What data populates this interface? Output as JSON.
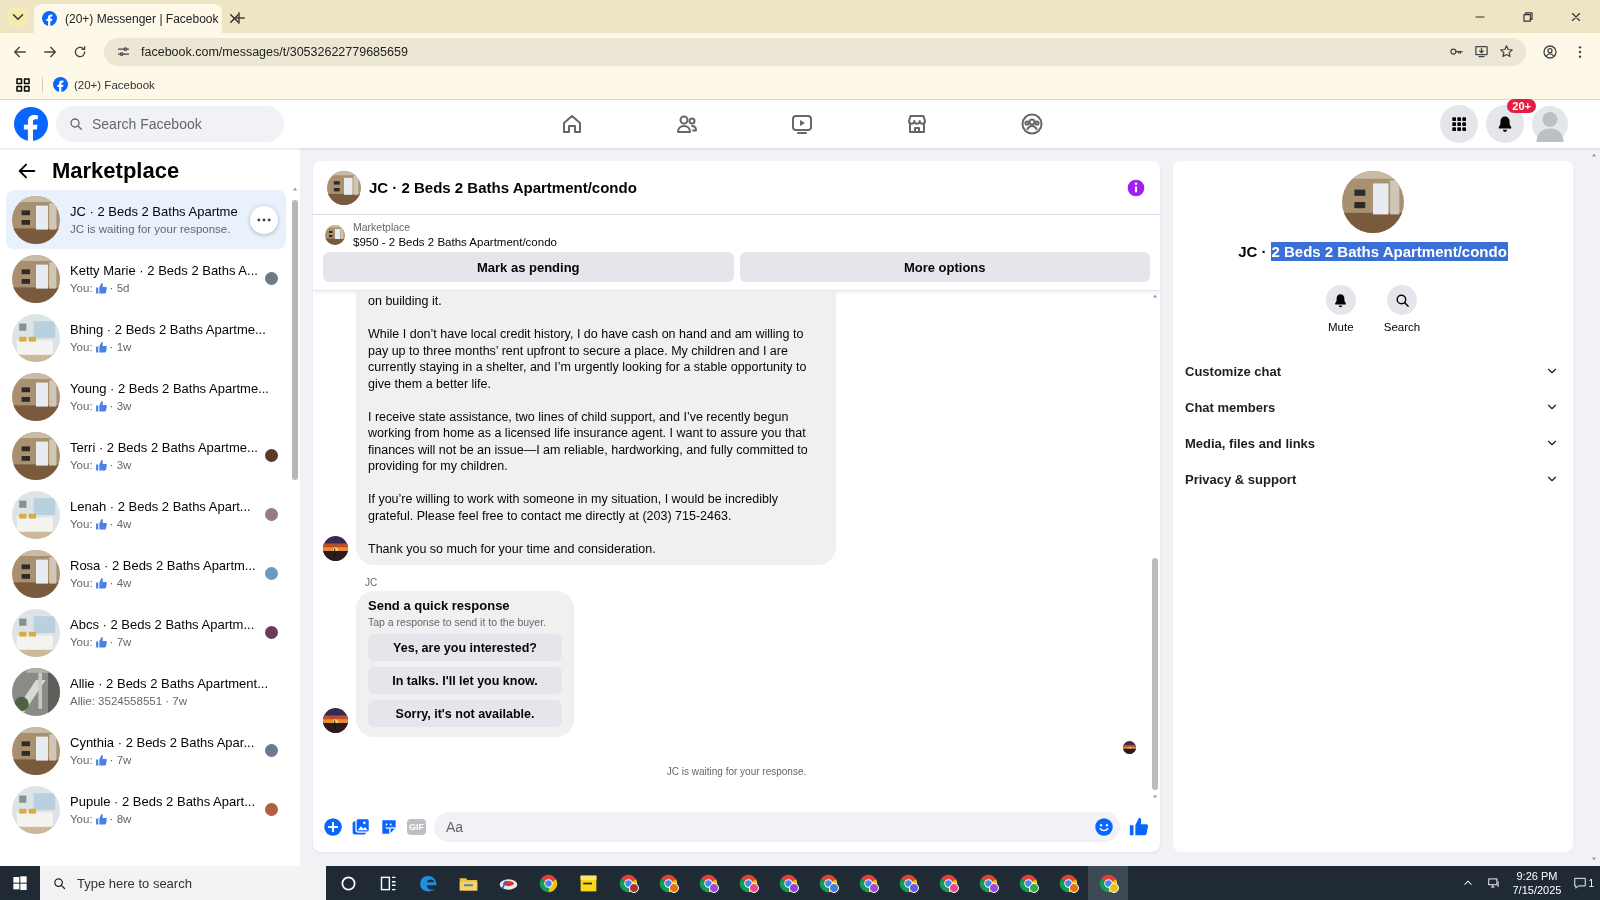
{
  "browser": {
    "tab_title": "(20+) Messenger | Facebook",
    "url": "facebook.com/messages/t/30532622779685659",
    "bookmark": "(20+) Facebook"
  },
  "header": {
    "search_placeholder": "Search Facebook",
    "nav": [
      {
        "kind": "home",
        "selected": false
      },
      {
        "kind": "friends",
        "selected": false
      },
      {
        "kind": "video",
        "selected": false
      },
      {
        "kind": "marketplace",
        "selected": false
      },
      {
        "kind": "groups",
        "selected": false
      }
    ],
    "notification_badge": "20+"
  },
  "sidebar": {
    "title": "Marketplace",
    "conversations": [
      {
        "title": "JC · 2 Beds 2 Baths Apartme",
        "kind": "text",
        "preview": "JC is waiting for your response.",
        "selected": true,
        "hovered": true,
        "seen": false
      },
      {
        "title": "Ketty Marie · 2 Beds 2 Baths A...",
        "kind": "like",
        "preview": "You:",
        "time": "· 5d",
        "selected": false,
        "hovered": false,
        "seen": true
      },
      {
        "title": "Bhing · 2 Beds 2 Baths Apartme...",
        "kind": "like",
        "preview": "You:",
        "time": "· 1w",
        "selected": false,
        "hovered": false,
        "seen": false
      },
      {
        "title": "Young · 2 Beds 2 Baths Apartme...",
        "kind": "like",
        "preview": "You:",
        "time": "· 3w",
        "selected": false,
        "hovered": false,
        "seen": false
      },
      {
        "title": "Terri · 2 Beds 2 Baths Apartme...",
        "kind": "like",
        "preview": "You:",
        "time": "· 3w",
        "selected": false,
        "hovered": false,
        "seen": true
      },
      {
        "title": "Lenah · 2 Beds 2 Baths Apart...",
        "kind": "like",
        "preview": "You:",
        "time": "· 4w",
        "selected": false,
        "hovered": false,
        "seen": true
      },
      {
        "title": "Rosa · 2 Beds 2 Baths Apartm...",
        "kind": "like",
        "preview": "You:",
        "time": "· 4w",
        "selected": false,
        "hovered": false,
        "seen": true
      },
      {
        "title": "Abcs · 2 Beds 2 Baths Apartm...",
        "kind": "like",
        "preview": "You:",
        "time": "· 7w",
        "selected": false,
        "hovered": false,
        "seen": true
      },
      {
        "title": "Allie · 2 Beds 2 Baths Apartment...",
        "kind": "text",
        "preview": "Allie: 3524558551 · 7w",
        "selected": false,
        "hovered": false,
        "seen": false
      },
      {
        "title": "Cynthia · 2 Beds 2 Baths Apar...",
        "kind": "like",
        "preview": "You:",
        "time": "· 7w",
        "selected": false,
        "hovered": false,
        "seen": true
      },
      {
        "title": "Pupule · 2 Beds 2 Baths Apart...",
        "kind": "like",
        "preview": "You:",
        "time": "· 8w",
        "selected": false,
        "hovered": false,
        "seen": true
      }
    ]
  },
  "chat": {
    "title": "JC · 2 Beds 2 Baths Apartment/condo",
    "listing": {
      "label": "Marketplace",
      "description": "$950 - 2 Beds 2 Baths Apartment/condo"
    },
    "actions": [
      "Mark as pending",
      "More options"
    ],
    "message": {
      "paragraphs": [
        "on building it.",
        "While I don’t have local credit history, I do have cash on hand and am willing to pay up to three months’ rent upfront to secure a place. My children and I are currently staying in a shelter, and I’m urgently looking for a stable opportunity to give them a better life.",
        "I receive state assistance, two lines of child support, and I’ve recently begun working from home as a licensed life insurance agent. I want to assure you that finances will not be an issue—I am reliable, hardworking, and fully committed to providing for my children.",
        "If you’re willing to work with someone in my situation, I would be incredibly grateful. Please feel free to contact me directly at (203) 715-2463.",
        "Thank you so much for your time and consideration."
      ]
    },
    "sender_label": "JC",
    "quick_response": {
      "title": "Send a quick response",
      "subtitle": "Tap a response to send it to the buyer.",
      "options": [
        "Yes, are you interested?",
        "In talks. I'll let you know.",
        "Sorry, it's not available."
      ]
    },
    "status": "JC is waiting for your response.",
    "composer": {
      "placeholder": "Aa",
      "gif_label": "GIF"
    }
  },
  "details": {
    "name_prefix": "JC ·",
    "name_selected": "2 Beds 2 Baths Apartment/condo",
    "selection_active": true,
    "actions": [
      {
        "kind": "mute",
        "label": "Mute"
      },
      {
        "kind": "search",
        "label": "Search"
      }
    ],
    "sections": [
      {
        "label": "Customize chat",
        "expanded": false
      },
      {
        "label": "Chat members",
        "expanded": false
      },
      {
        "label": "Media, files and links",
        "expanded": false
      },
      {
        "label": "Privacy & support",
        "expanded": false
      }
    ]
  },
  "taskbar": {
    "search_placeholder": "Type here to search",
    "apps": [
      {
        "kind": "cortana",
        "active": false
      },
      {
        "kind": "taskview",
        "active": false
      },
      {
        "kind": "edge",
        "active": false
      },
      {
        "kind": "explorer",
        "active": false
      },
      {
        "kind": "app",
        "active": false
      },
      {
        "kind": "chrome",
        "active": false
      },
      {
        "kind": "notes",
        "active": false
      },
      {
        "kind": "chrome-profile",
        "color": "#a83232",
        "active": false
      },
      {
        "kind": "chrome-profile",
        "color": "#e8710a",
        "active": false
      },
      {
        "kind": "chrome-profile",
        "color": "#9c4ad8",
        "active": false
      },
      {
        "kind": "chrome-profile",
        "color": "#e84a8a",
        "active": false
      },
      {
        "kind": "chrome-profile",
        "color": "#8e44d8",
        "active": false
      },
      {
        "kind": "chrome-profile",
        "color": "#4a7ad8",
        "active": false
      },
      {
        "kind": "chrome-profile",
        "color": "#a04ad8",
        "active": false
      },
      {
        "kind": "chrome-profile",
        "color": "#6a5ae0",
        "active": false
      },
      {
        "kind": "chrome-profile",
        "color": "#e84a8a",
        "active": false
      },
      {
        "kind": "chrome-profile",
        "color": "#9c4ad8",
        "active": false
      },
      {
        "kind": "chrome-profile",
        "color": "#34a853",
        "active": false
      },
      {
        "kind": "chrome-profile",
        "color": "#e8710a",
        "active": false
      },
      {
        "kind": "chrome-profile",
        "color": "#e8c20a",
        "active": true
      }
    ],
    "time": "9:26 PM",
    "date": "7/15/2025",
    "notification_count": "1"
  }
}
